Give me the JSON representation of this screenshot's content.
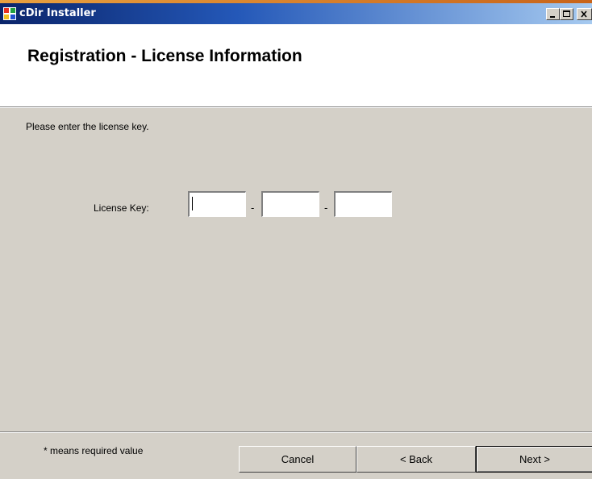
{
  "window": {
    "title": "cDir Installer",
    "title_bar_color": "#0a246a",
    "icon": "installer-app-icon"
  },
  "header": {
    "title": "Registration - License Information"
  },
  "body": {
    "instructions": "Please enter the license key.",
    "license_label": "License Key:",
    "separator": "-",
    "key_parts": [
      {
        "value": ""
      },
      {
        "value": ""
      },
      {
        "value": ""
      }
    ]
  },
  "footer": {
    "note": "* means required value",
    "cancel_label": "Cancel",
    "back_label": "< Back",
    "next_label": "Next >"
  }
}
